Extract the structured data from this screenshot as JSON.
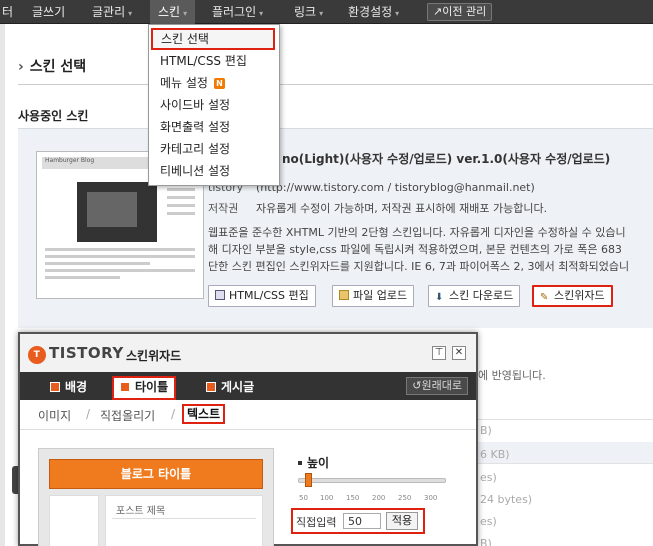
{
  "nav": {
    "items": [
      {
        "label": "터"
      },
      {
        "label": "글쓰기"
      },
      {
        "label": "글관리",
        "arrow": "▾"
      },
      {
        "label": "스킨",
        "arrow": "▾"
      },
      {
        "label": "플러그인",
        "arrow": "▾"
      },
      {
        "label": "링크",
        "arrow": "▾"
      },
      {
        "label": "환경설정",
        "arrow": "▾"
      }
    ],
    "prev_admin": "↗이전 관리"
  },
  "dropdown": {
    "items": [
      {
        "label": "스킨 선택"
      },
      {
        "label": "HTML/CSS 편집"
      },
      {
        "label": "메뉴 설정",
        "badge": "N"
      },
      {
        "label": "사이드바 설정"
      },
      {
        "label": "화면출력 설정"
      },
      {
        "label": "카테고리 설정"
      },
      {
        "label": "티베니션 설정"
      }
    ]
  },
  "page": {
    "section_title": "스킨 선택",
    "chevron": "›",
    "sub_title": "사용중인 스킨"
  },
  "skin": {
    "name": "no(Light)(사용자 수정/업로드) ver.1.0(사용자 수정/업로드)",
    "author_key": "tistory",
    "author_val": "(http://www.tistory.com / tistoryblog@hanmail.net)",
    "copyright_key": "저작권",
    "copyright_val": "자유롭게 수정이 가능하며, 저작권 표시하에 재배포 가능합니다.",
    "desc_lines": [
      "웹표준을 준수한 XHTML 기반의 2단형 스킨입니다. 자유롭게 디자인을 수정하실 수 있습니",
      "해 디자인 부분을 style,css 파일에 독립시켜 적용하였으며, 본문 컨텐츠의 가로 폭은 683",
      "단한 스킨 편집인 스킨위자드를 지원합니다. IE 6, 7과 파이어폭스 2, 3에서 최적화되었습니"
    ],
    "thumb_title": "Hamburger Blog",
    "buttons": {
      "html_css": "HTML/CSS 편집",
      "upload": "파일 업로드",
      "download": "스킨 다운로드",
      "wizard": "스킨위자드"
    }
  },
  "background": {
    "applied_text": "에 반영됩니다.",
    "rows": [
      "B)",
      "6 KB)",
      "es)",
      "24 bytes)",
      "es)",
      "B)"
    ]
  },
  "wizard": {
    "logo_dot": "T",
    "logo": "TISTORY",
    "title": "스킨위자드",
    "pin": "⊤",
    "close": "✕",
    "tabs": {
      "bg": "배경",
      "title": "타이틀",
      "post": "게시글"
    },
    "reset": "↺원래대로",
    "subtabs": {
      "image": "이미지",
      "direct_upload": "직접올리기",
      "text": "텍스트",
      "slash": "/"
    },
    "preview_title": "블로그 타이틀",
    "post_title": "포스트 제목",
    "height_label": "높이",
    "ticks": [
      "50",
      "100",
      "150",
      "200",
      "250",
      "300"
    ],
    "direct_input_label": "직접입력",
    "direct_input_value": "50",
    "apply": "적용"
  }
}
